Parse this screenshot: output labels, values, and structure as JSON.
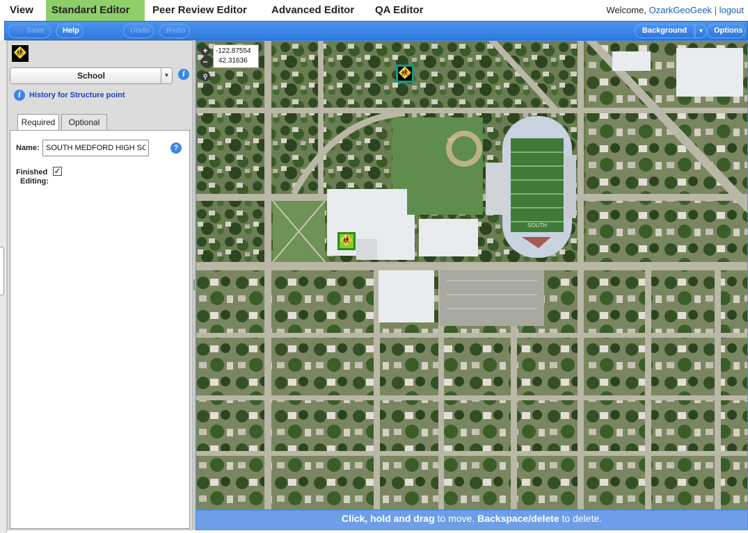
{
  "nav": {
    "tabs": [
      {
        "label": "View"
      },
      {
        "label": "Standard Editor"
      },
      {
        "label": "Peer Review Editor"
      },
      {
        "label": "Advanced Editor"
      },
      {
        "label": "QA Editor"
      }
    ],
    "active_tab": "Standard Editor",
    "welcome_text": "Welcome,",
    "username": "OzarkGeoGeek",
    "separator": "|",
    "logout": "logout"
  },
  "toolbar": {
    "save_label": "Save",
    "help_label": "Help",
    "undo_label": "Undo",
    "redo_label": "Redo",
    "background_label": "Background",
    "options_label": "Options"
  },
  "panel": {
    "feature_type": "School",
    "history_link": "History for Structure point",
    "tabs": {
      "required": "Required",
      "optional": "Optional"
    },
    "active_tab": "Required",
    "fields": {
      "name_label": "Name:",
      "name_value": "SOUTH MEDFORD HIGH SCHOOL",
      "finished_label_1": "Finished",
      "finished_label_2": "Editing:",
      "finished_checked": true
    }
  },
  "map": {
    "longitude": "-122.87554",
    "latitude": "42.31636",
    "field_text": "SOUTH",
    "colors": {
      "vegetation": "#3c5a2a",
      "road": "#b9b7a6",
      "roof": "#e9ecee",
      "field_turf": "#5f8d4e",
      "selected_marker": "#7fcf3a",
      "marker_border": "#0e9b8a"
    }
  },
  "status": {
    "part1_bold": "Click, hold and drag",
    "part2": " to move. ",
    "part3_bold": "Backspace/delete",
    "part4": " to delete."
  },
  "icons": {
    "save": "pencil-icon",
    "school": "school-children-icon",
    "info": "info-icon",
    "help": "question-icon",
    "zoom_in": "plus-icon",
    "zoom_out": "minus-icon",
    "search": "magnifier-icon"
  }
}
